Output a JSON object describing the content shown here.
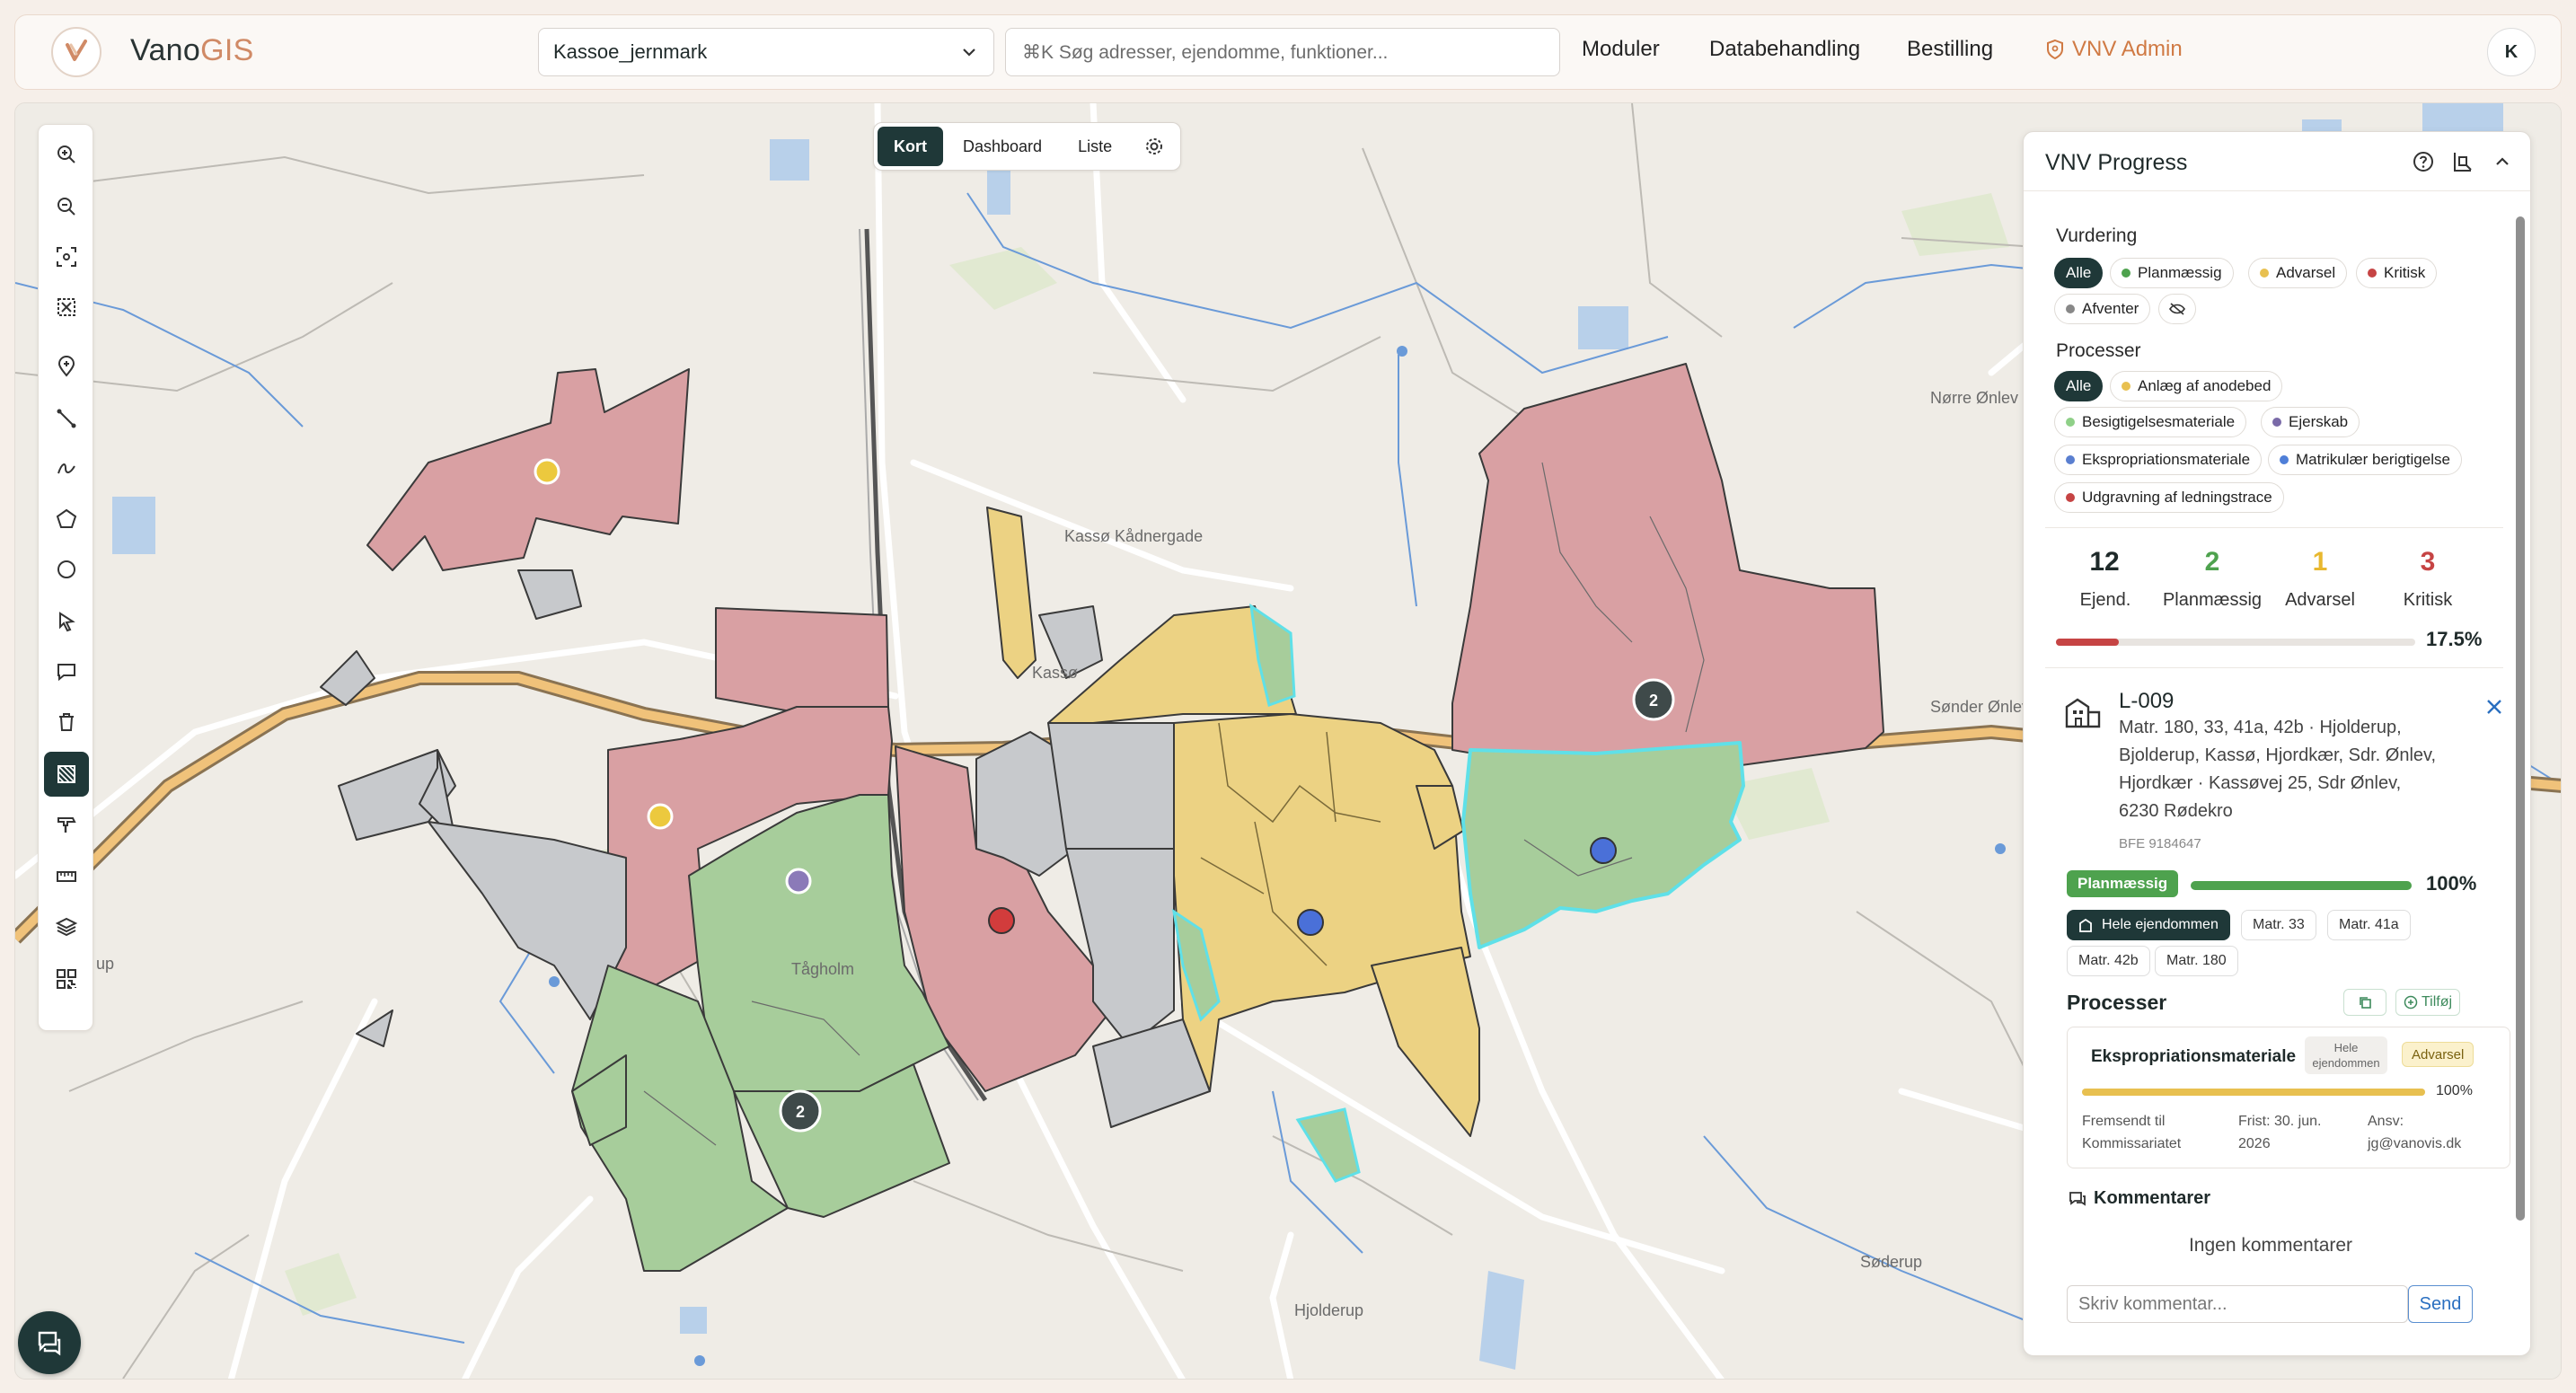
{
  "header": {
    "logo_part1": "Vano",
    "logo_part2": "GIS",
    "project": "Kassoe_jernmark",
    "search_placeholder": "⌘K Søg adresser, ejendomme, funktioner...",
    "nav": [
      "Moduler",
      "Databehandling",
      "Bestilling"
    ],
    "admin_label": "VNV Admin",
    "user_initial": "K"
  },
  "view_tabs": [
    "Kort",
    "Dashboard",
    "Liste"
  ],
  "map": {
    "labels": [
      "Kassø Kådnergade",
      "Kassø",
      "Tågholm",
      "Hjolderup",
      "Sønder Ønlev",
      "Nørre Ønlev",
      "Søderup",
      "up"
    ],
    "cluster_counts": [
      "2",
      "2"
    ]
  },
  "panel": {
    "title": "VNV Progress",
    "vurdering": {
      "label": "Vurdering",
      "chips": [
        {
          "label": "Alle",
          "color": ""
        },
        {
          "label": "Planmæssig",
          "color": "#4ea24e"
        },
        {
          "label": "Advarsel",
          "color": "#e8c050"
        },
        {
          "label": "Kritisk",
          "color": "#c64444"
        },
        {
          "label": "Afventer",
          "color": "#888888"
        }
      ]
    },
    "processer": {
      "label": "Processer",
      "chips": [
        {
          "label": "Alle",
          "color": ""
        },
        {
          "label": "Anlæg af anodebed",
          "color": "#e8c050"
        },
        {
          "label": "Besigtigelsesmateriale",
          "color": "#8fd088"
        },
        {
          "label": "Ejerskab",
          "color": "#7a6aa8"
        },
        {
          "label": "Ekspropriationsmateriale",
          "color": "#5a7fd0"
        },
        {
          "label": "Matrikulær berigtigelse",
          "color": "#4f7fd8"
        },
        {
          "label": "Udgravning af ledningstrace",
          "color": "#c64444"
        }
      ]
    },
    "stats": [
      {
        "value": "12",
        "label": "Ejend.",
        "color": "#1f2a2a"
      },
      {
        "value": "2",
        "label": "Planmæssig",
        "color": "#4ea24e"
      },
      {
        "value": "1",
        "label": "Advarsel",
        "color": "#e8b830"
      },
      {
        "value": "3",
        "label": "Kritisk",
        "color": "#c64444"
      }
    ],
    "progress_pct": "17.5%",
    "progress_value": 17.5,
    "property": {
      "id": "L-009",
      "address": "Matr. 180, 33, 41a, 42b · Hjolderup, Bjolderup, Kassø, Hjordkær, Sdr. Ønlev, Hjordkær · Kassøvej 25, Sdr Ønlev, 6230 Rødekro",
      "bfe": "BFE 9184647",
      "status": "Planmæssig",
      "status_pct": "100%",
      "status_value": 100,
      "matr_chips": [
        "Hele ejendommen",
        "Matr. 33",
        "Matr. 41a",
        "Matr. 42b",
        "Matr. 180"
      ]
    },
    "processes_title": "Processer",
    "add_label": "Tilføj",
    "process_card": {
      "name": "Ekspropriationsmateriale",
      "scope": "Hele ejendommen",
      "status": "Advarsel",
      "pct": "100%",
      "pct_value": 100,
      "col1": "Fremsendt til Kommissariatet",
      "col2": "Frist: 30. jun. 2026",
      "col3": "Ansv: jg@vanovis.dk"
    },
    "comments_title": "Kommentarer",
    "no_comments": "Ingen kommentarer",
    "comment_placeholder": "Skriv kommentar...",
    "send_label": "Send"
  }
}
